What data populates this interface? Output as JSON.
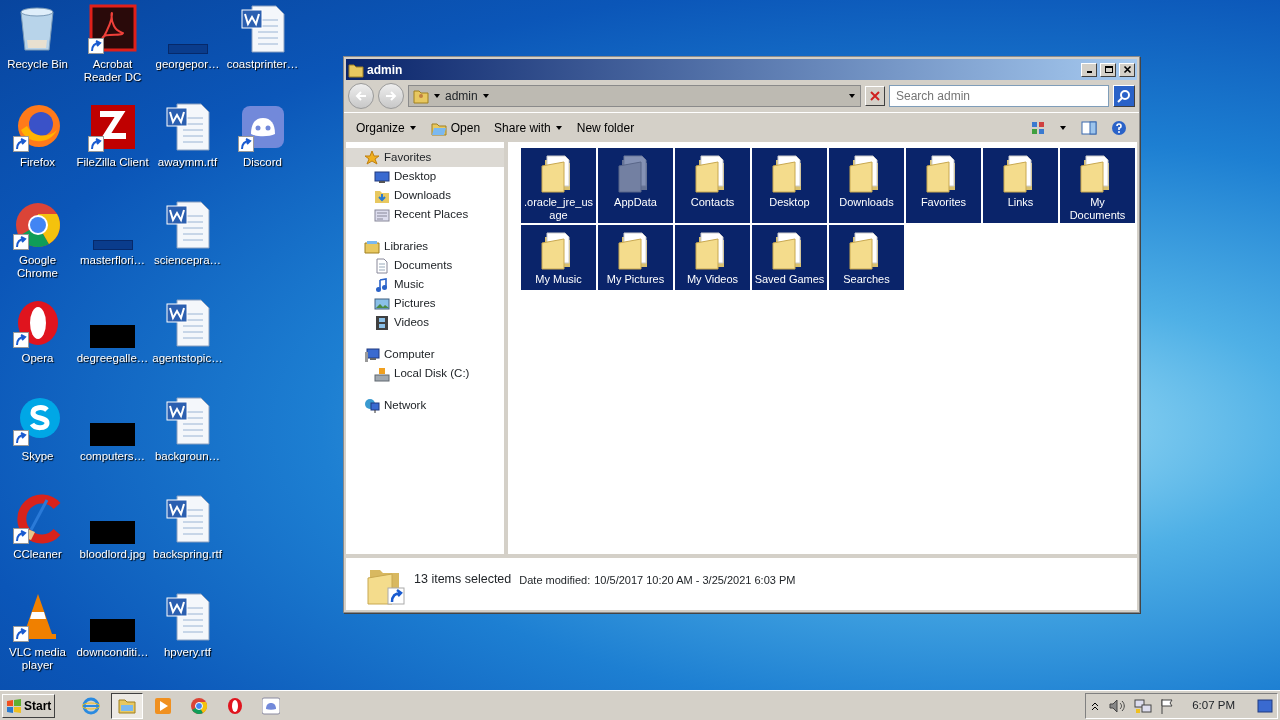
{
  "desktop_icons": [
    {
      "label": "Recycle Bin",
      "kind": "recycle",
      "shortcut": false
    },
    {
      "label": "Firefox",
      "kind": "firefox",
      "shortcut": true
    },
    {
      "label": "Google Chrome",
      "kind": "chrome",
      "shortcut": true
    },
    {
      "label": "Opera",
      "kind": "opera",
      "shortcut": true
    },
    {
      "label": "Skype",
      "kind": "skype",
      "shortcut": true
    },
    {
      "label": "CCleaner",
      "kind": "ccleaner",
      "shortcut": true
    },
    {
      "label": "VLC media player",
      "kind": "vlc",
      "shortcut": true
    },
    {
      "label": "Acrobat Reader DC",
      "kind": "acrobat",
      "shortcut": true
    },
    {
      "label": "FileZilla Client",
      "kind": "filezilla",
      "shortcut": true
    },
    {
      "label": "masterflori…",
      "kind": "blank",
      "shortcut": false
    },
    {
      "label": "degreegalle…",
      "kind": "black",
      "shortcut": false
    },
    {
      "label": "computers…",
      "kind": "black",
      "shortcut": false
    },
    {
      "label": "bloodlord.jpg",
      "kind": "black",
      "shortcut": false
    },
    {
      "label": "downconditi…",
      "kind": "black",
      "shortcut": false
    },
    {
      "label": "georgepor…",
      "kind": "blank",
      "shortcut": false
    },
    {
      "label": "awaymm.rtf",
      "kind": "word",
      "shortcut": false
    },
    {
      "label": "sciencepra…",
      "kind": "word",
      "shortcut": false
    },
    {
      "label": "agentstopic…",
      "kind": "word",
      "shortcut": false
    },
    {
      "label": "backgroun…",
      "kind": "word",
      "shortcut": false
    },
    {
      "label": "backspring.rtf",
      "kind": "word",
      "shortcut": false
    },
    {
      "label": "hpvery.rtf",
      "kind": "word",
      "shortcut": false
    },
    {
      "label": "coastprinter…",
      "kind": "word",
      "shortcut": false
    },
    {
      "label": "Discord",
      "kind": "discord",
      "shortcut": true
    }
  ],
  "window": {
    "title": "admin",
    "address": {
      "crumb": "admin"
    },
    "search": {
      "placeholder": "Search admin"
    },
    "commands": [
      {
        "label": "Organize",
        "dropdown": true,
        "kind": "text"
      },
      {
        "label": "Open",
        "dropdown": false,
        "kind": "open"
      },
      {
        "label": "Share with",
        "dropdown": true,
        "kind": "text"
      },
      {
        "label": "New folder",
        "dropdown": false,
        "kind": "text"
      }
    ],
    "nav": [
      {
        "label": "Favorites",
        "kind": "star",
        "selected": true,
        "children": [
          {
            "label": "Desktop",
            "kind": "desktop",
            "selected": false
          },
          {
            "label": "Downloads",
            "kind": "downloads",
            "selected": false
          },
          {
            "label": "Recent Places",
            "kind": "recent",
            "selected": false
          }
        ]
      },
      {
        "label": "Libraries",
        "kind": "library",
        "selected": false,
        "children": [
          {
            "label": "Documents",
            "kind": "documents",
            "selected": false
          },
          {
            "label": "Music",
            "kind": "music",
            "selected": false
          },
          {
            "label": "Pictures",
            "kind": "pictures",
            "selected": false
          },
          {
            "label": "Videos",
            "kind": "videos",
            "selected": false
          }
        ]
      },
      {
        "label": "Computer",
        "kind": "computer",
        "selected": false,
        "children": [
          {
            "label": "Local Disk (C:)",
            "kind": "disk",
            "selected": false
          }
        ]
      },
      {
        "label": "Network",
        "kind": "network",
        "selected": false
      }
    ],
    "folders": [
      {
        "label": ".oracle_jre_usage",
        "selected": true,
        "hidden": false
      },
      {
        "label": "AppData",
        "selected": true,
        "hidden": true
      },
      {
        "label": "Contacts",
        "selected": true,
        "hidden": false
      },
      {
        "label": "Desktop",
        "selected": true,
        "hidden": false
      },
      {
        "label": "Downloads",
        "selected": true,
        "hidden": false
      },
      {
        "label": "Favorites",
        "selected": true,
        "hidden": false
      },
      {
        "label": "Links",
        "selected": true,
        "hidden": false
      },
      {
        "label": "My Documents",
        "selected": true,
        "hidden": false
      },
      {
        "label": "My Music",
        "selected": true,
        "hidden": false
      },
      {
        "label": "My Pictures",
        "selected": true,
        "hidden": false
      },
      {
        "label": "My Videos",
        "selected": true,
        "hidden": false
      },
      {
        "label": "Saved Games",
        "selected": true,
        "hidden": false
      },
      {
        "label": "Searches",
        "selected": true,
        "hidden": false
      }
    ],
    "details": {
      "summary": "13 items selected",
      "field_label": "Date modified:",
      "field_value": "10/5/2017 10:20 AM - 3/25/2021 6:03 PM"
    }
  },
  "taskbar": {
    "start": "Start",
    "apps": [
      {
        "kind": "ie",
        "active": false
      },
      {
        "kind": "explorer",
        "active": true
      },
      {
        "kind": "media",
        "active": false
      },
      {
        "kind": "chrome",
        "active": false
      },
      {
        "kind": "opera",
        "active": false
      },
      {
        "kind": "discord",
        "active": false
      }
    ],
    "clock": "6:07 PM"
  }
}
